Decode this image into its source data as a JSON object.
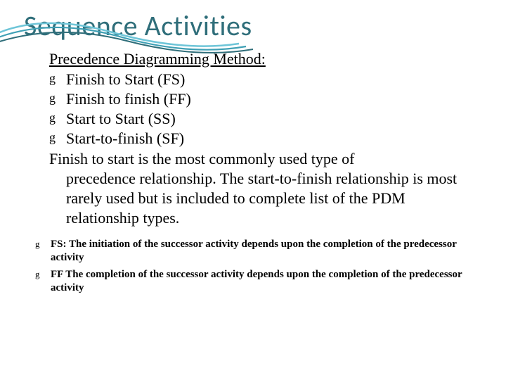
{
  "title": "Sequence Activities",
  "subheading": "Precedence Diagramming Method:",
  "bullets": [
    "Finish to Start (FS)",
    "Finish to finish (FF)",
    "Start to Start (SS)",
    "Start-to-finish (SF)"
  ],
  "paragraph_first": "Finish to start is the most commonly used type of",
  "paragraph_rest": "precedence relationship. The start-to-finish relationship is most rarely used but is included to complete list of the PDM relationship types.",
  "small_bullets": [
    "FS: The initiation of the successor activity depends upon the completion of the predecessor activity",
    "FF The completion of the successor activity depends upon the completion of the predecessor activity"
  ],
  "bullet_glyph": "g",
  "colors": {
    "title": "#2F6E7A",
    "wave1": "#6EC5D8",
    "wave2": "#3FA0B5",
    "wave3": "#2F6E7A"
  }
}
